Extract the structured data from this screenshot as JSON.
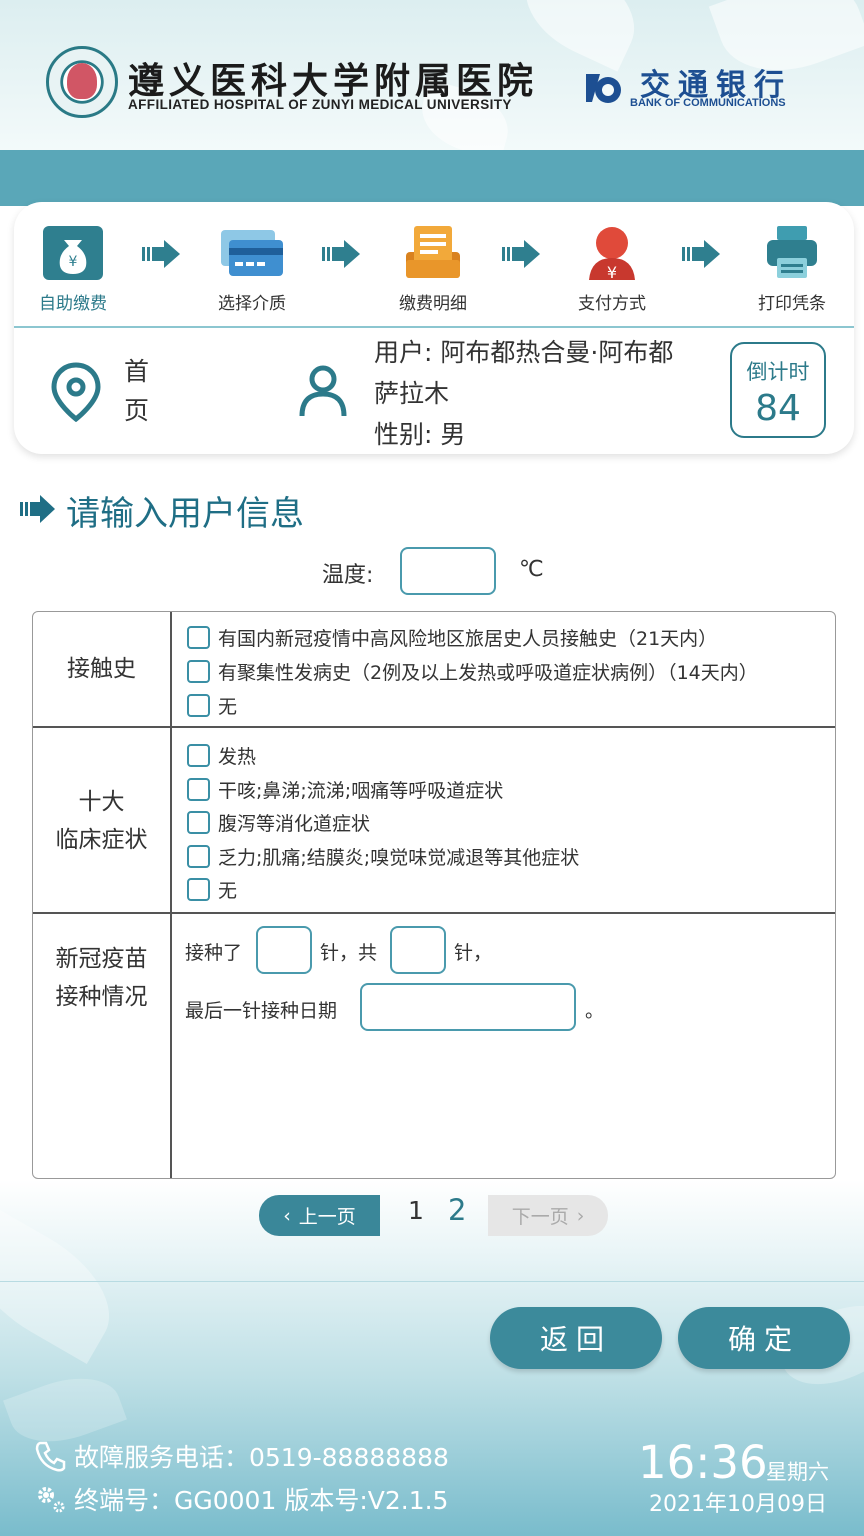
{
  "header": {
    "hospital_name_cn": "遵义医科大学附属医院",
    "hospital_name_en": "AFFILIATED HOSPITAL OF ZUNYI MEDICAL UNIVERSITY",
    "bank_name_cn": "交通银行",
    "bank_name_en": "BANK OF COMMUNICATIONS"
  },
  "steps": [
    {
      "label": "自助缴费",
      "icon": "money-bag-icon",
      "active": true
    },
    {
      "label": "选择介质",
      "icon": "card-icon",
      "active": false
    },
    {
      "label": "缴费明细",
      "icon": "receipt-list-icon",
      "active": false
    },
    {
      "label": "支付方式",
      "icon": "yuan-payment-icon",
      "active": false
    },
    {
      "label": "打印凭条",
      "icon": "printer-icon",
      "active": false
    }
  ],
  "info": {
    "home_label": "首页",
    "user_line": "用户: 阿布都热合曼·阿布都萨拉木",
    "gender_line": "性别: 男",
    "countdown_label": "倒计时",
    "countdown_value": "84"
  },
  "section": {
    "title": "请输入用户信息",
    "temperature_label": "温度:",
    "temperature_value": "",
    "temperature_unit": "℃"
  },
  "form": {
    "contact": {
      "label": "接触史",
      "options": [
        "有国内新冠疫情中高风险地区旅居史人员接触史（21天内）",
        "有聚集性发病史（2例及以上发热或呼吸道症状病例）（14天内）",
        "无"
      ]
    },
    "symptoms": {
      "label_line1": "十大",
      "label_line2": "临床症状",
      "options": [
        "发热",
        "干咳;鼻涕;流涕;咽痛等呼吸道症状",
        "腹泻等消化道症状",
        "乏力;肌痛;结膜炎;嗅觉味觉减退等其他症状",
        "无"
      ]
    },
    "vaccine": {
      "label_line1": "新冠疫苗",
      "label_line2": "接种情况",
      "text_received": "接种了",
      "text_dose_total": "针，共",
      "text_dose_end": "针，",
      "text_last_date": "最后一针接种日期",
      "text_period": "。",
      "doses_received": "",
      "doses_total": "",
      "last_date": ""
    }
  },
  "pagination": {
    "prev_label": "上一页",
    "next_label": "下一页",
    "pages": [
      "1",
      "2"
    ],
    "current_page": "2"
  },
  "actions": {
    "back_label": "返回",
    "confirm_label": "确定"
  },
  "footer": {
    "service_phone": "故障服务电话：0519-88888888",
    "terminal_info": "终端号：GG0001 版本号:V2.1.5",
    "time": "16:36",
    "weekday": "星期六",
    "date": "2021年10月09日"
  },
  "colors": {
    "primary": "#3c8a9b",
    "accent_text": "#2c7a8a",
    "band": "#5aa7b8",
    "bank_blue": "#1d4f92",
    "step_orange": "#e9a02f",
    "step_red": "#d8443a"
  }
}
